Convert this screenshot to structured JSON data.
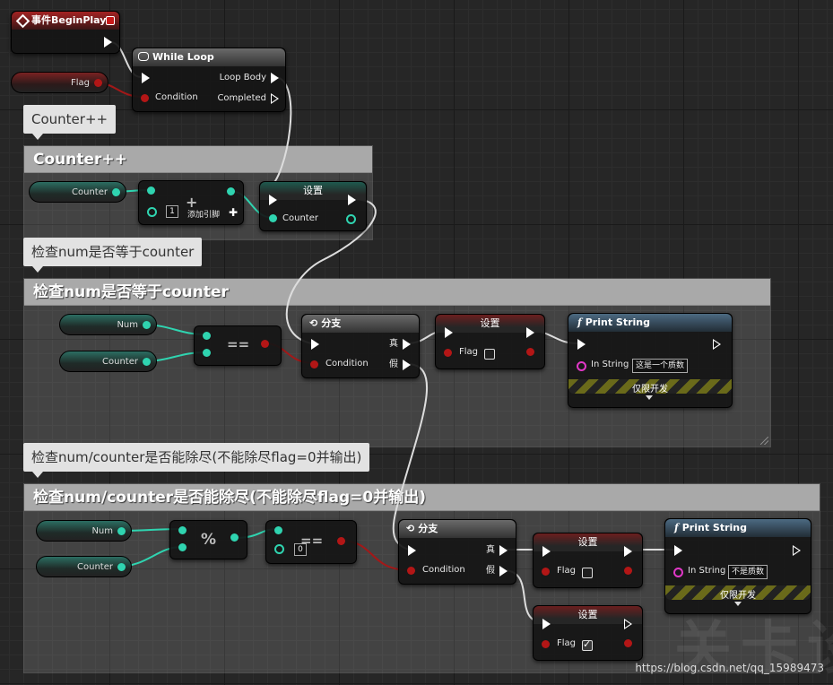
{
  "event": {
    "title": "事件BeginPlay"
  },
  "flag_var": {
    "label": "Flag"
  },
  "while_loop": {
    "title": "While Loop",
    "loop_body": "Loop Body",
    "condition": "Condition",
    "completed": "Completed"
  },
  "comment1": {
    "bubble": "Counter++",
    "header": "Counter++"
  },
  "counter_var1": {
    "label": "Counter"
  },
  "add_node": {
    "plus": "+",
    "add_pin": "添加引脚",
    "value": "1"
  },
  "set_counter": {
    "title": "设置",
    "pin": "Counter"
  },
  "comment2": {
    "bubble": "检查num是否等于counter",
    "header": "检查num是否等于counter"
  },
  "num_var2": {
    "label": "Num"
  },
  "counter_var2": {
    "label": "Counter"
  },
  "eq_node2": {
    "op": "=="
  },
  "branch2": {
    "title": "分支",
    "true_label": "真",
    "condition": "Condition",
    "false_label": "假"
  },
  "set_flag2": {
    "title": "设置",
    "pin": "Flag"
  },
  "print2": {
    "title": "Print String",
    "in_string": "In String",
    "value": "这是一个质数",
    "dev": "仅限开发"
  },
  "comment3": {
    "bubble": "检查num/counter是否能除尽(不能除尽flag=0并输出)",
    "header": "检查num/counter是否能除尽(不能除尽flag=0并输出)"
  },
  "num_var3": {
    "label": "Num"
  },
  "counter_var3": {
    "label": "Counter"
  },
  "mod_node": {
    "op": "%"
  },
  "eq_node3": {
    "op": "==",
    "value": "0"
  },
  "branch3": {
    "title": "分支",
    "true_label": "真",
    "condition": "Condition",
    "false_label": "假"
  },
  "set_flag3a": {
    "title": "设置",
    "pin": "Flag"
  },
  "set_flag3b": {
    "title": "设置",
    "pin": "Flag"
  },
  "print3": {
    "title": "Print String",
    "in_string": "In String",
    "value": "不是质数",
    "dev": "仅限开发"
  },
  "watermark": {
    "url": "https://blog.csdn.net/qq_15989473",
    "chars": "关卡设"
  },
  "colors": {
    "exec": "#ffffff",
    "bool": "#b31616",
    "int": "#2fd4b0",
    "string": "#e238c8",
    "event_header": "#a42323",
    "function_header": "#4c6a82"
  }
}
